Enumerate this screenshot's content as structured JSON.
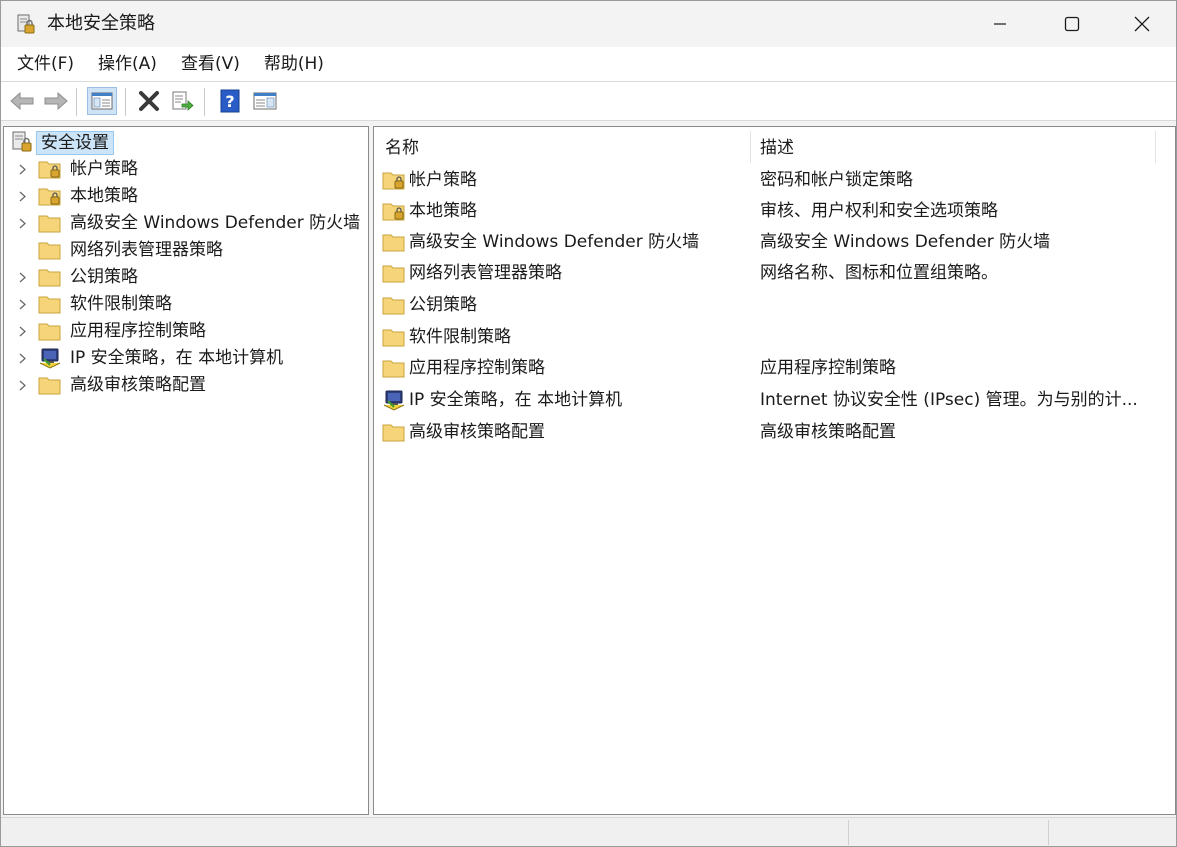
{
  "window": {
    "title": "本地安全策略"
  },
  "menubar": {
    "items": [
      "文件(F)",
      "操作(A)",
      "查看(V)",
      "帮助(H)"
    ]
  },
  "tree": {
    "root": {
      "label": "安全设置"
    },
    "items": [
      {
        "label": "帐户策略",
        "icon": "locked-folder-icon",
        "expandable": true
      },
      {
        "label": "本地策略",
        "icon": "locked-folder-icon",
        "expandable": true
      },
      {
        "label": "高级安全 Windows Defender 防火墙",
        "icon": "folder-icon",
        "expandable": true
      },
      {
        "label": "网络列表管理器策略",
        "icon": "folder-icon",
        "expandable": false
      },
      {
        "label": "公钥策略",
        "icon": "folder-icon",
        "expandable": true
      },
      {
        "label": "软件限制策略",
        "icon": "folder-icon",
        "expandable": true
      },
      {
        "label": "应用程序控制策略",
        "icon": "folder-icon",
        "expandable": true
      },
      {
        "label": "IP 安全策略，在 本地计算机",
        "icon": "ip-security-icon",
        "expandable": true
      },
      {
        "label": "高级审核策略配置",
        "icon": "folder-icon",
        "expandable": true
      }
    ]
  },
  "list": {
    "columns": {
      "name": "名称",
      "description": "描述"
    },
    "rows": [
      {
        "name": "帐户策略",
        "description": "密码和帐户锁定策略",
        "icon": "locked-folder-icon"
      },
      {
        "name": "本地策略",
        "description": "审核、用户权利和安全选项策略",
        "icon": "locked-folder-icon"
      },
      {
        "name": "高级安全 Windows Defender 防火墙",
        "description": "高级安全 Windows Defender 防火墙",
        "icon": "folder-icon"
      },
      {
        "name": "网络列表管理器策略",
        "description": "网络名称、图标和位置组策略。",
        "icon": "folder-icon"
      },
      {
        "name": "公钥策略",
        "description": "",
        "icon": "folder-icon"
      },
      {
        "name": "软件限制策略",
        "description": "",
        "icon": "folder-icon"
      },
      {
        "name": "应用程序控制策略",
        "description": "应用程序控制策略",
        "icon": "folder-icon"
      },
      {
        "name": "IP 安全策略，在 本地计算机",
        "description": "Internet 协议安全性 (IPsec) 管理。为与别的计...",
        "icon": "ip-security-icon"
      },
      {
        "name": "高级审核策略配置",
        "description": "高级审核策略配置",
        "icon": "folder-icon"
      }
    ]
  },
  "colors": {
    "selection_bg": "#cce4f7",
    "selection_border": "#99c9ef",
    "folder_yellow": "#f6d57a",
    "help_blue": "#2a5cc7"
  }
}
